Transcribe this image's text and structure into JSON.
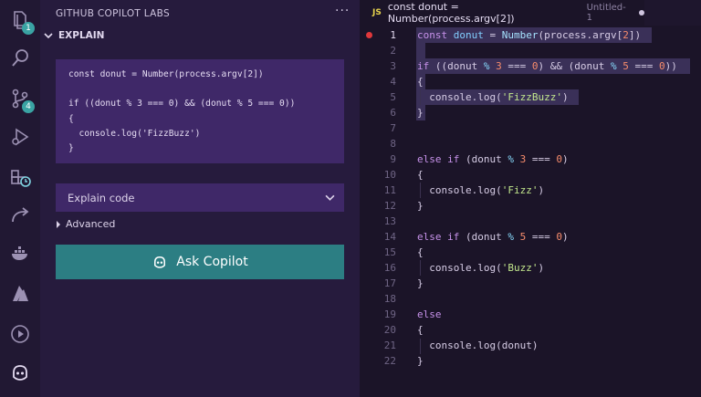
{
  "activity_bar": {
    "items": [
      {
        "icon": "files-icon",
        "badge": "1"
      },
      {
        "icon": "search-icon"
      },
      {
        "icon": "source-control-icon",
        "badge": "4"
      },
      {
        "icon": "run-debug-icon"
      },
      {
        "icon": "extensions-icon"
      },
      {
        "icon": "remote-icon"
      },
      {
        "icon": "docker-icon"
      },
      {
        "icon": "azure-icon"
      },
      {
        "icon": "play-icon"
      },
      {
        "icon": "copilot-icon"
      }
    ]
  },
  "sidebar": {
    "title": "GITHUB COPILOT LABS",
    "more": "···",
    "section_title": "EXPLAIN",
    "code_lines": [
      "const donut = Number(process.argv[2])",
      "",
      "if ((donut % 3 === 0) && (donut % 5 === 0))",
      "{",
      "  console.log('FizzBuzz')",
      "}"
    ],
    "select_value": "Explain code",
    "advanced_label": "Advanced",
    "ask_button_label": "Ask Copilot"
  },
  "tab": {
    "lang_badge": "JS",
    "title": "const donut = Number(process.argv[2])",
    "path": "Untitled-1"
  },
  "editor": {
    "line_numbers": [
      "1",
      "2",
      "3",
      "4",
      "5",
      "6",
      "7",
      "8",
      "9",
      "10",
      "11",
      "12",
      "13",
      "14",
      "15",
      "16",
      "17",
      "18",
      "19",
      "20",
      "21",
      "22"
    ],
    "active_line": "1",
    "colors": {
      "keyword": "#c792ea",
      "number": "#f78c6c",
      "string": "#c3e88d",
      "selection": "#3a3058",
      "accent": "#2c7e83"
    }
  }
}
